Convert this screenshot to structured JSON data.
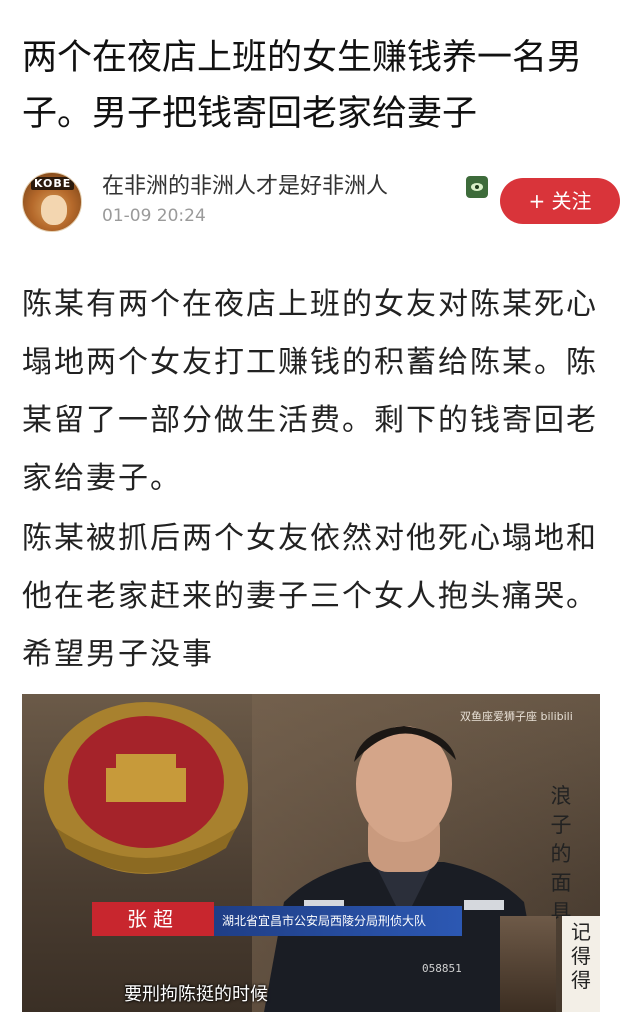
{
  "post": {
    "title": "两个在夜店上班的女生赚钱养一名男子。男子把钱寄回老家给妻子"
  },
  "author": {
    "avatar_text": "KOBE",
    "name": "在非洲的非洲人才是好非洲人",
    "time": "01-09 20:24",
    "badge_icon": "eye-icon"
  },
  "follow": {
    "label": "+ 关注",
    "color": "#d9343a"
  },
  "content": {
    "paragraphs": [
      "陈某有两个在夜店上班的女友对陈某死心塌地两个女友打工赚钱的积蓄给陈某。陈某留了一部分做生活费。剩下的钱寄回老家给妻子。",
      "陈某被抓后两个女友依然对他死心塌地和他在老家赶来的妻子三个女人抱头痛哭。希望男子没事"
    ]
  },
  "video": {
    "watermark": "双鱼座爱狮子座 bilibili",
    "side_caption": "浪子的面具",
    "name_plate": "张超",
    "title_plate": "湖北省宜昌市公安局西陵分局刑侦大队",
    "badge_number": "058851",
    "subtitle": "要刑拘陈挺的时候",
    "corner_caption": "记得得"
  }
}
